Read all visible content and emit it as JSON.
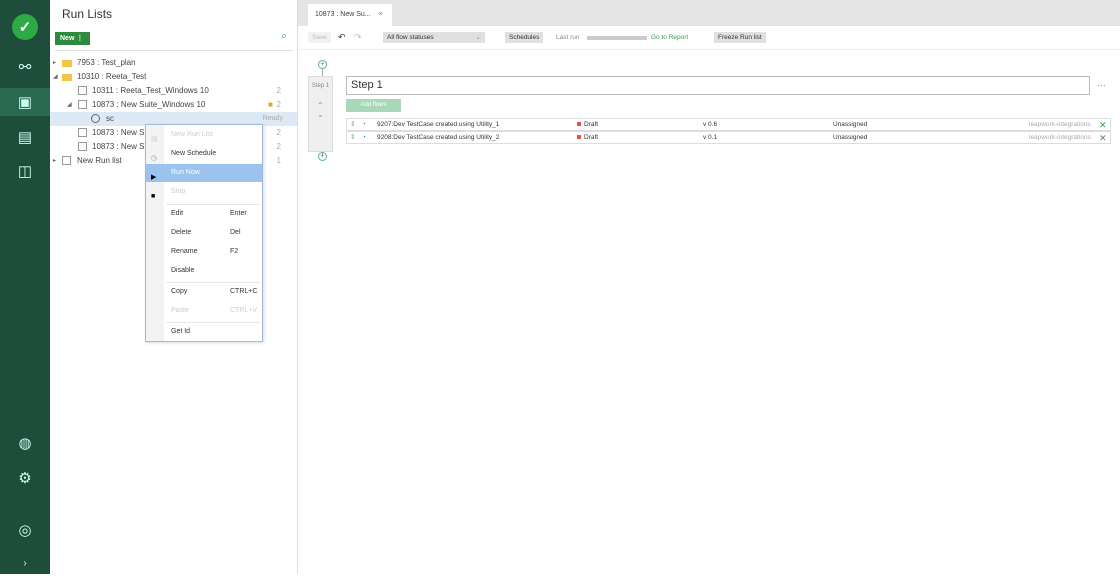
{
  "nav": {
    "icons": [
      "logo-check",
      "share-icon",
      "schedule-icon",
      "excel-icon",
      "dashboard-icon",
      "globe-icon",
      "gear-icon",
      "help-icon",
      "expand-icon"
    ]
  },
  "panel": {
    "title": "Run Lists",
    "new_label": "New",
    "tree": [
      {
        "label": "7953 : Test_plan",
        "count": ""
      },
      {
        "label": "10310 : Reeta_Test",
        "count": ""
      },
      {
        "label": "10311 : Reeta_Test_Windows 10",
        "count": "2"
      },
      {
        "label": "10873 : New Suite_Windows 10",
        "count": "2"
      },
      {
        "label": "sc",
        "count": "Ready"
      },
      {
        "label": "10873 : New Su",
        "count": "2"
      },
      {
        "label": "10873 : New Su",
        "count": "2"
      },
      {
        "label": "New Run list",
        "count": "1"
      }
    ]
  },
  "menu": {
    "items": [
      {
        "label": "New Run List",
        "key": ""
      },
      {
        "label": "New Schedule",
        "key": ""
      },
      {
        "label": "Run Now",
        "key": ""
      },
      {
        "label": "Stop",
        "key": ""
      },
      {
        "label": "Edit",
        "key": "Enter"
      },
      {
        "label": "Delete",
        "key": "Del"
      },
      {
        "label": "Rename",
        "key": "F2"
      },
      {
        "label": "Disable",
        "key": ""
      },
      {
        "label": "Copy",
        "key": "CTRL+C"
      },
      {
        "label": "Paste",
        "key": "CTRL+V"
      },
      {
        "label": "Get Id",
        "key": ""
      }
    ]
  },
  "tab": {
    "label": "10873 : New Su...",
    "close": "×"
  },
  "toolbar": {
    "save": "Save",
    "filter": "All flow statuses",
    "schedules": "Schedules",
    "last_run": "Last run",
    "go_report": "Go to Report",
    "freeze": "Freeze Run list"
  },
  "step": {
    "side_label": "Step 1",
    "name": "Step 1",
    "add_flows": "Add flows",
    "more": "···",
    "flows": [
      {
        "name": "9207:Dev TestCase created using Utility_1",
        "status": "Draft",
        "version": "v 0.6",
        "assignee": "Unassigned",
        "project": "leapwork-integrations"
      },
      {
        "name": "9208:Dev TestCase created using Utility_2",
        "status": "Draft",
        "version": "v 0.1",
        "assignee": "Unassigned",
        "project": "leapwork-integrations"
      }
    ]
  }
}
